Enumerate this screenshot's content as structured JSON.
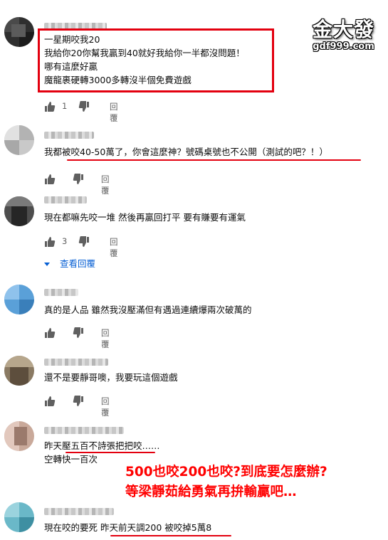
{
  "watermark": {
    "brand": "金大發",
    "domain": "gdf999.com"
  },
  "overlay": {
    "line1": "500也咬200也咬?到底要怎麼辦?",
    "line2": "等梁靜茹給勇氣再拚輸贏吧…"
  },
  "reply_label": "回覆",
  "view_replies_label": "查看回覆",
  "comments": [
    {
      "lines": [
        "一星期咬我20",
        "我給你20你幫我贏到40就好我給你一半都沒問題！",
        "哪有這麼好贏",
        "魔龍裹硬轉3000多轉沒半個免費遊戲"
      ],
      "likes": "1"
    },
    {
      "lines": [
        "我都被咬40-50萬了，你會這麼神？號碼桌號也不公開（測試的吧？！）"
      ],
      "likes": ""
    },
    {
      "lines": [
        "現在都嘛先咬一堆 然後再贏回打平 要有賺要有運氣"
      ],
      "likes": "3"
    },
    {
      "lines": [
        "真的是人品 雖然我沒壓滿但有遇過連續爆兩次破萬的"
      ],
      "likes": ""
    },
    {
      "lines": [
        "還不是要靜哥噢，我要玩這個遊戲"
      ],
      "likes": ""
    },
    {
      "lines": [
        "昨天壓五百不詩張把把咬……",
        "空轉快一百次"
      ],
      "likes": ""
    },
    {
      "lines": [
        "現在咬的要死 昨天前天調200 被咬掉5萬8"
      ],
      "likes": ""
    }
  ],
  "colors": {
    "highlight": "#e3000f",
    "link": "#065fd4",
    "meta": "#606060"
  }
}
